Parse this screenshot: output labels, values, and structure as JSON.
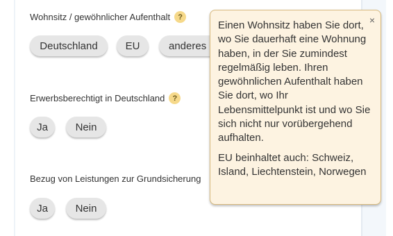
{
  "questions": [
    {
      "label": "Wohnsitz / gewöhnlicher Aufenthalt",
      "options": [
        "Deutschland",
        "EU",
        "anderes Land"
      ]
    },
    {
      "label": "Erwerbsberechtigt in Deutschland",
      "options": [
        "Ja",
        "Nein"
      ]
    },
    {
      "label": "Bezug von Leistungen zur Grundsicherung",
      "options": [
        "Ja",
        "Nein"
      ]
    }
  ],
  "help_icon": {
    "glyph": "?",
    "name": "help-icon"
  },
  "tooltip": {
    "paragraph_1": "Einen Wohnsitz haben Sie dort, wo Sie dauerhaft eine Wohnung haben, in der Sie zumindest regelmäßig leben. Ihren gewöhnlichen Aufenthalt haben Sie dort, wo Ihr Lebensmittelpunkt ist und wo Sie sich nicht nur vorübergehend aufhalten.",
    "paragraph_2": "EU beinhaltet auch: Schweiz, Island, Liechtenstein, Norwegen",
    "close_glyph": "×"
  },
  "colors": {
    "pill_bg": "#e6e6e6",
    "help_icon_bg": "#f6d98a",
    "tooltip_bg": "#fdf3e1",
    "tooltip_border": "#d6b87c"
  }
}
